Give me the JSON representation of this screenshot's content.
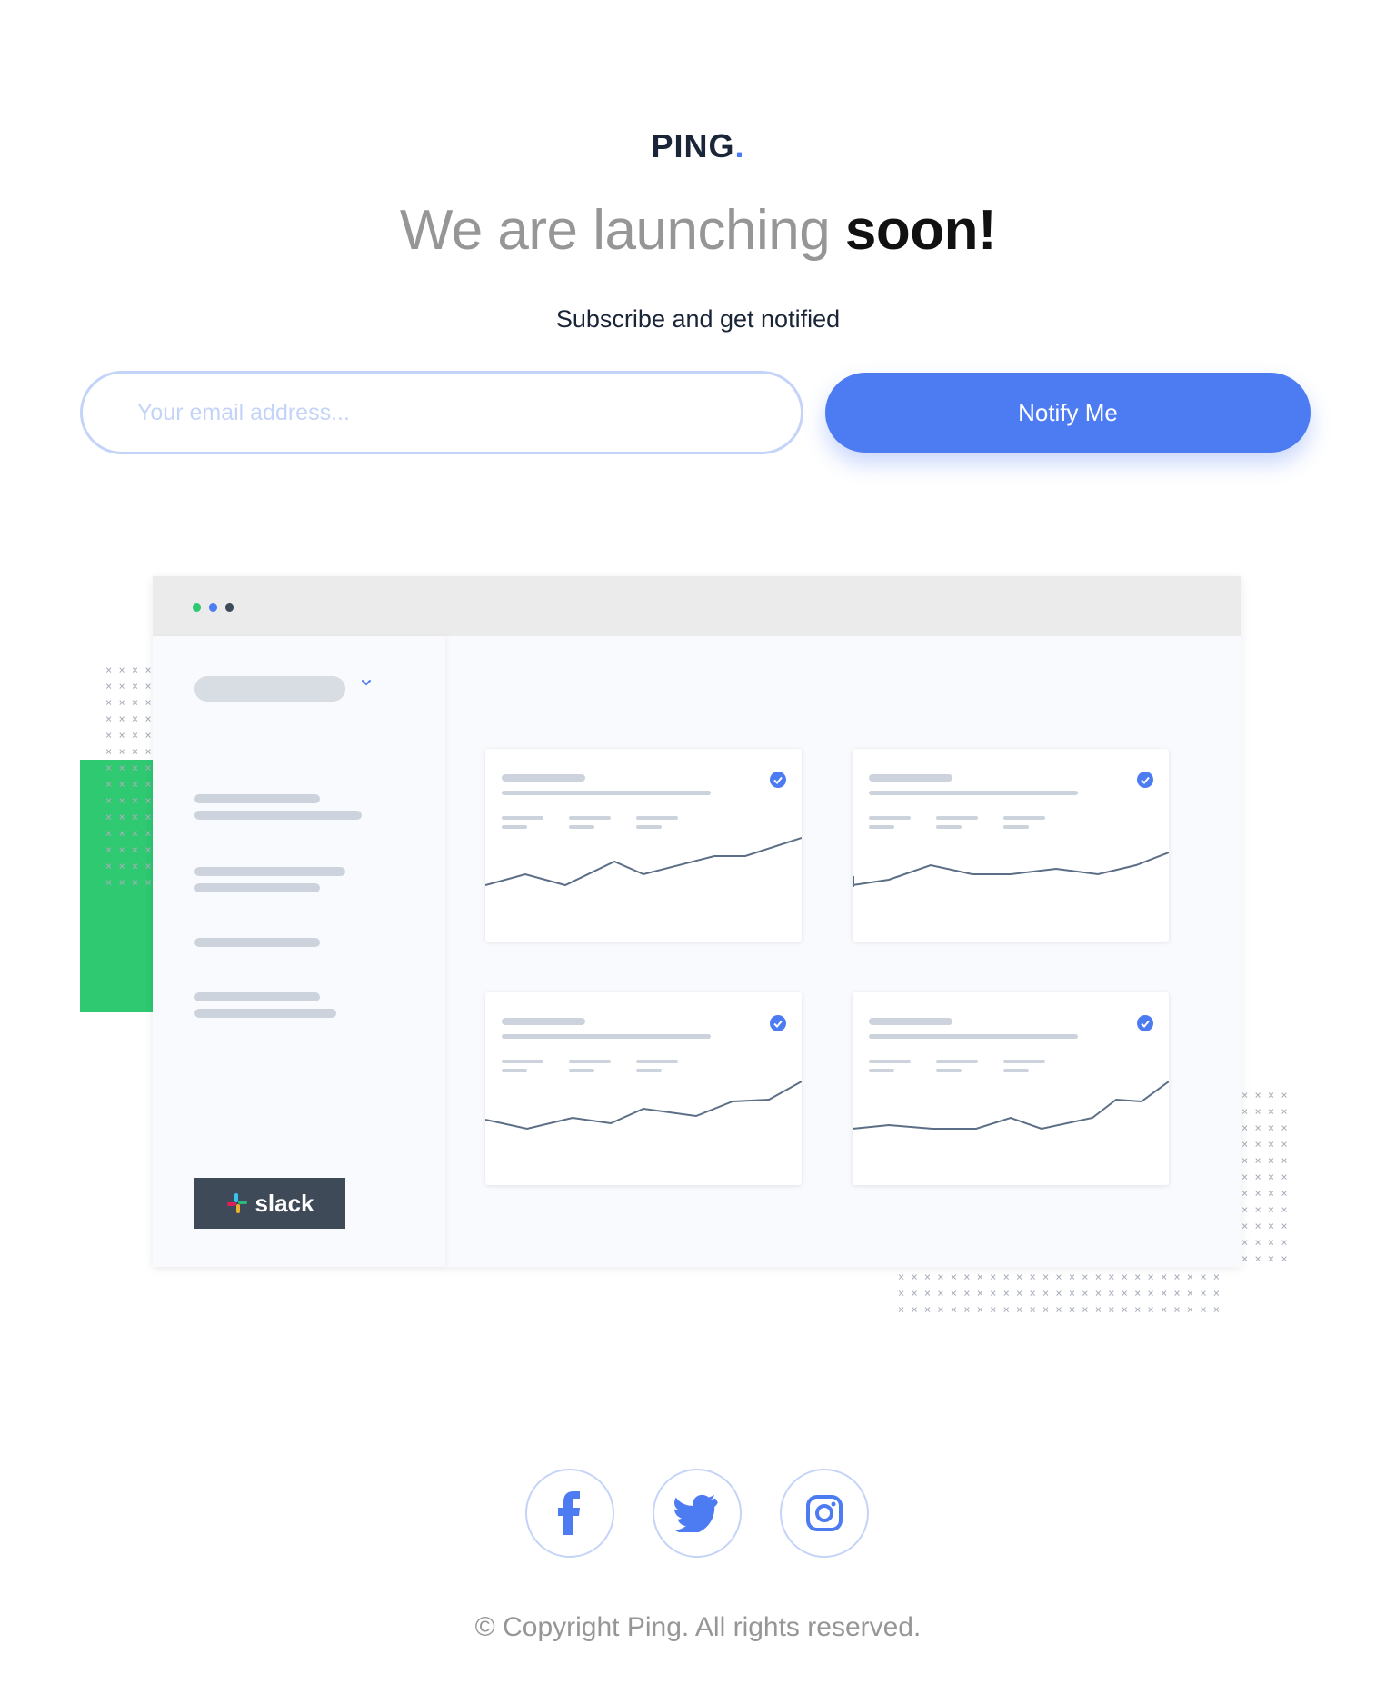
{
  "brand": {
    "name": "PING",
    "dot": "."
  },
  "hero": {
    "title_light": "We are launching ",
    "title_bold": "soon!",
    "subtitle": "Subscribe and get notified"
  },
  "form": {
    "email_placeholder": "Your email address...",
    "email_value": "",
    "submit_label": "Notify Me"
  },
  "illustration": {
    "slack_label": "slack",
    "window_dot_colors": [
      "#2ec971",
      "#4d7cf2",
      "#3f4a58"
    ],
    "cards": [
      {
        "checked": true,
        "trend": "line"
      },
      {
        "checked": true,
        "trend": "line"
      },
      {
        "checked": true,
        "trend": "line"
      },
      {
        "checked": true,
        "trend": "line"
      }
    ]
  },
  "social": [
    {
      "name": "facebook",
      "icon": "facebook-icon"
    },
    {
      "name": "twitter",
      "icon": "twitter-icon"
    },
    {
      "name": "instagram",
      "icon": "instagram-icon"
    }
  ],
  "footer": {
    "copyright": "© Copyright Ping. All rights reserved."
  },
  "colors": {
    "accent": "#4d7cf2",
    "accent_light": "#c4d3f8",
    "green": "#2ec971",
    "dark": "#1b2538",
    "gray_text": "#969696"
  }
}
